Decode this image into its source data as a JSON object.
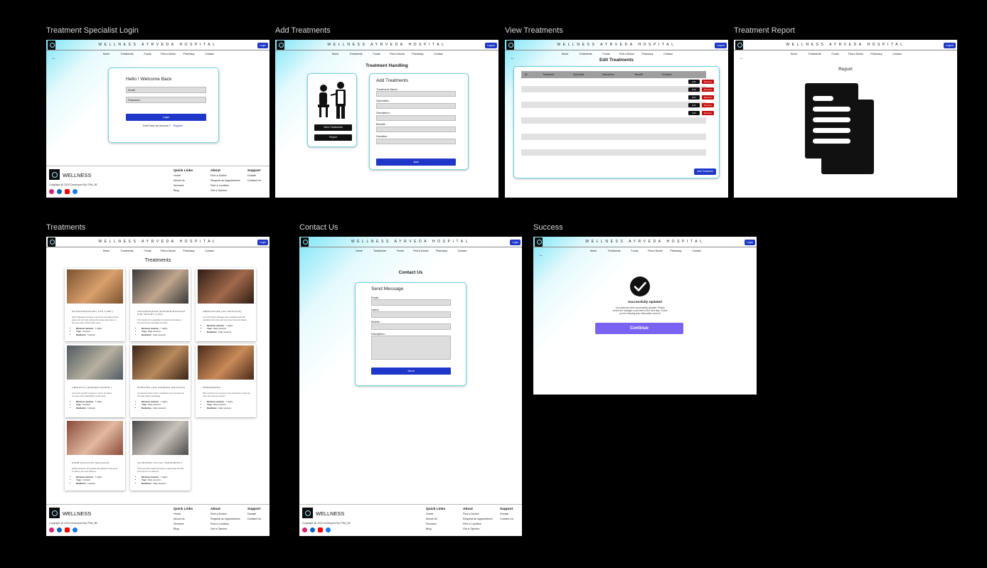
{
  "frames": {
    "login": {
      "title": "Treatment Specialist Login"
    },
    "add": {
      "title": "Add Treatments"
    },
    "view": {
      "title": "View Treatments"
    },
    "report": {
      "title": "Treatment Report"
    },
    "treatments": {
      "title": "Treatments"
    },
    "contact": {
      "title": "Contact Us"
    },
    "success": {
      "title": "Success"
    }
  },
  "header": {
    "hospital_name": "WELLNESS AYRVEDA HOSPITAL",
    "login_label": "Login",
    "logout_label": "Logout",
    "nav": [
      "Home",
      "Treatments",
      "Foods",
      "Find a Doctor",
      "Pharmacy",
      "Contact"
    ],
    "back_icon": "arrow-left-icon"
  },
  "login": {
    "heading": "Hello ! Welcome Back",
    "email_placeholder": "Email",
    "password_placeholder": "Password",
    "submit": "Login",
    "no_account": "Don't have an account ?",
    "register": "Register"
  },
  "add": {
    "page_title": "Treatment Handling",
    "view_button": "View Treatments",
    "report_button": "Report",
    "form_title": "Add Treatments",
    "fields": [
      "Treatment Name :",
      "Specialist :",
      "Discription :",
      "Benefit :",
      "Duration :"
    ],
    "submit": "Add"
  },
  "view": {
    "title": "Edit Treatments",
    "columns": [
      "ID",
      "Treatment",
      "Specialist",
      "Discription",
      "Benefit",
      "Duration"
    ],
    "edit_label": "Edit",
    "remove_label": "Remove",
    "add_button": "Add Treatment"
  },
  "report": {
    "title": "Report",
    "icon": "document-copy-icon"
  },
  "treatments": {
    "page_title": "Treatments",
    "labels": {
      "min": "Minimum duration",
      "yoga": "Yoga",
      "med": "Meditation"
    },
    "cards": [
      {
        "title": "NETRATARPANAM ( EYE CARE )",
        "desc": "Netra Tarpanam therapy is good for controlling visual signs and can help reduce the stress and strain on the eyes and nourish optic nerve.",
        "min": "7 nights",
        "yoga": "Included",
        "med": "Included",
        "color1": "#7a5230",
        "color2": "#d9a06c"
      },
      {
        "title": "UDVARTHANAM (POWDER MASSAGE FOR WEIGHT LOSS)",
        "desc": "This treatment is available for obesity and helps to remove fat and stimulate the body.",
        "min": "7 nights",
        "yoga": "Daily sessions",
        "med": "Daily sessions",
        "color1": "#3a3a3a",
        "color2": "#bfa58d"
      },
      {
        "title": "ABHYANGAM (OIL MASSAGE)",
        "desc": "It is a full body massage with medicated oils that nourishes the body and improves blood circulation.",
        "min": "7 nights",
        "yoga": "Daily sessions",
        "med": "Daily sessions",
        "color1": "#2e1d14",
        "color2": "#a0694b"
      },
      {
        "title": "CHIKITSA ( REHABILITATION )",
        "desc": "Ayurvedic specific treatment course for faster recovery and rehabilitation of the body.",
        "min": "7 nights",
        "yoga": "Included",
        "med": "Included",
        "color1": "#4f5a60",
        "color2": "#b7b0a0"
      },
      {
        "title": "PIZHICHIL (OIL POURING MASSAGE)",
        "desc": "A treatment where warm medicated oil is poured over the body while massaging.",
        "min": "7 nights",
        "yoga": "Daily sessions",
        "med": "Daily sessions",
        "color1": "#3b2418",
        "color2": "#b88a5c"
      },
      {
        "title": "SHIRODHARA",
        "desc": "Warm herbal oil is poured on the forehead to relax the mind and nervous system.",
        "min": "7 nights",
        "yoga": "Daily sessions",
        "med": "Daily sessions",
        "color1": "#4a2a1a",
        "color2": "#c98a58"
      },
      {
        "title": "KIZHI (POULTICE MASSAGE)",
        "desc": "Herbal poultices are heated and applied to the body to relieve pain and stiffness.",
        "min": "7 nights",
        "yoga": "Included",
        "med": "Included",
        "color1": "#8a4a3a",
        "color2": "#e2b9a0"
      },
      {
        "title": "AYURVEDIC FACIAL TREATMENTS",
        "desc": "This Ayurvedic treatment helps to rejuvenate the skin and improve complexion.",
        "min": "7 nights",
        "yoga": "Daily sessions",
        "med": "Daily sessions",
        "color1": "#4b4b4b",
        "color2": "#c9c2bb"
      }
    ]
  },
  "contact": {
    "page_title": "Contact Us",
    "form_title": "Send Message",
    "fields": [
      "Email :",
      "Name :",
      "Mobile :",
      "Discription :"
    ],
    "submit": "Send"
  },
  "success": {
    "heading": "Successfully Updated",
    "message": "Your data has been successfully updated. Please review the changes or proceed to the next step. Thank you for keeping your information current!",
    "button": "Continue",
    "icon": "check-circle-icon"
  },
  "footer": {
    "brand": "WELLNESS",
    "copyright": "Copyright @ 2024 Developed By ITRA_B2",
    "social_icons": [
      "instagram-icon",
      "linkedin-icon",
      "youtube-icon",
      "facebook-icon"
    ],
    "social_colors": [
      "#d6246e",
      "#0a66c2",
      "#ff0000",
      "#1877f2"
    ],
    "cols": [
      {
        "heading": "Quick Links",
        "items": [
          "Home",
          "About Us",
          "Services",
          "Blog"
        ]
      },
      {
        "heading": "About",
        "items": [
          "Find a Doctor",
          "Request an Appointment",
          "Find a Location",
          "Get a Opinion"
        ]
      },
      {
        "heading": "Support",
        "items": [
          "Donate",
          "Contact Us"
        ]
      }
    ]
  },
  "colors": {
    "primary": "#1f37c8",
    "success_button": "#7a63f2",
    "remove": "#c40f0f"
  }
}
